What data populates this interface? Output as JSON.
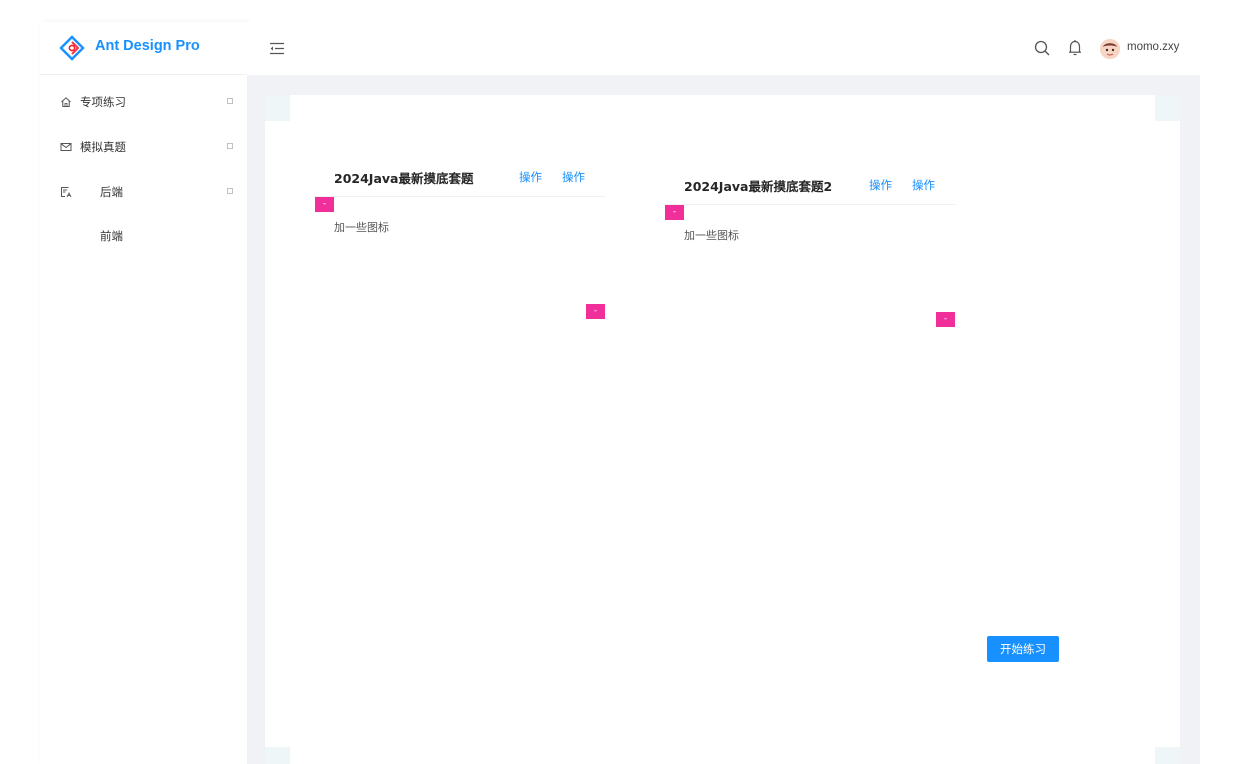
{
  "app": {
    "logo_text": "Ant Design Pro"
  },
  "sidebar": {
    "items": [
      {
        "label": "专项练习",
        "icon": "home-icon",
        "has_arrow": true
      },
      {
        "label": "模拟真题",
        "icon": "mail-icon",
        "has_arrow": true
      },
      {
        "label": "后端",
        "icon": "form-icon",
        "has_arrow": true
      },
      {
        "label": "前端",
        "icon": "",
        "has_arrow": false
      }
    ]
  },
  "header": {
    "username": "momo.zxy",
    "icons": [
      "menu-fold-icon",
      "search-icon",
      "bell-icon",
      "avatar"
    ]
  },
  "cards": [
    {
      "title": "2024Java最新摸底套题",
      "actions": [
        "操作",
        "操作"
      ],
      "description": "加一些图标",
      "tags": [
        "-",
        "-"
      ]
    },
    {
      "title": "2024Java最新摸底套题2",
      "actions": [
        "操作",
        "操作"
      ],
      "description": "加一些图标",
      "tags": [
        "-",
        "-"
      ]
    }
  ],
  "start_button": "开始练习",
  "colors": {
    "primary": "#1890ff",
    "tag": "#f12f9a",
    "content_bg": "#f0f2f5"
  }
}
